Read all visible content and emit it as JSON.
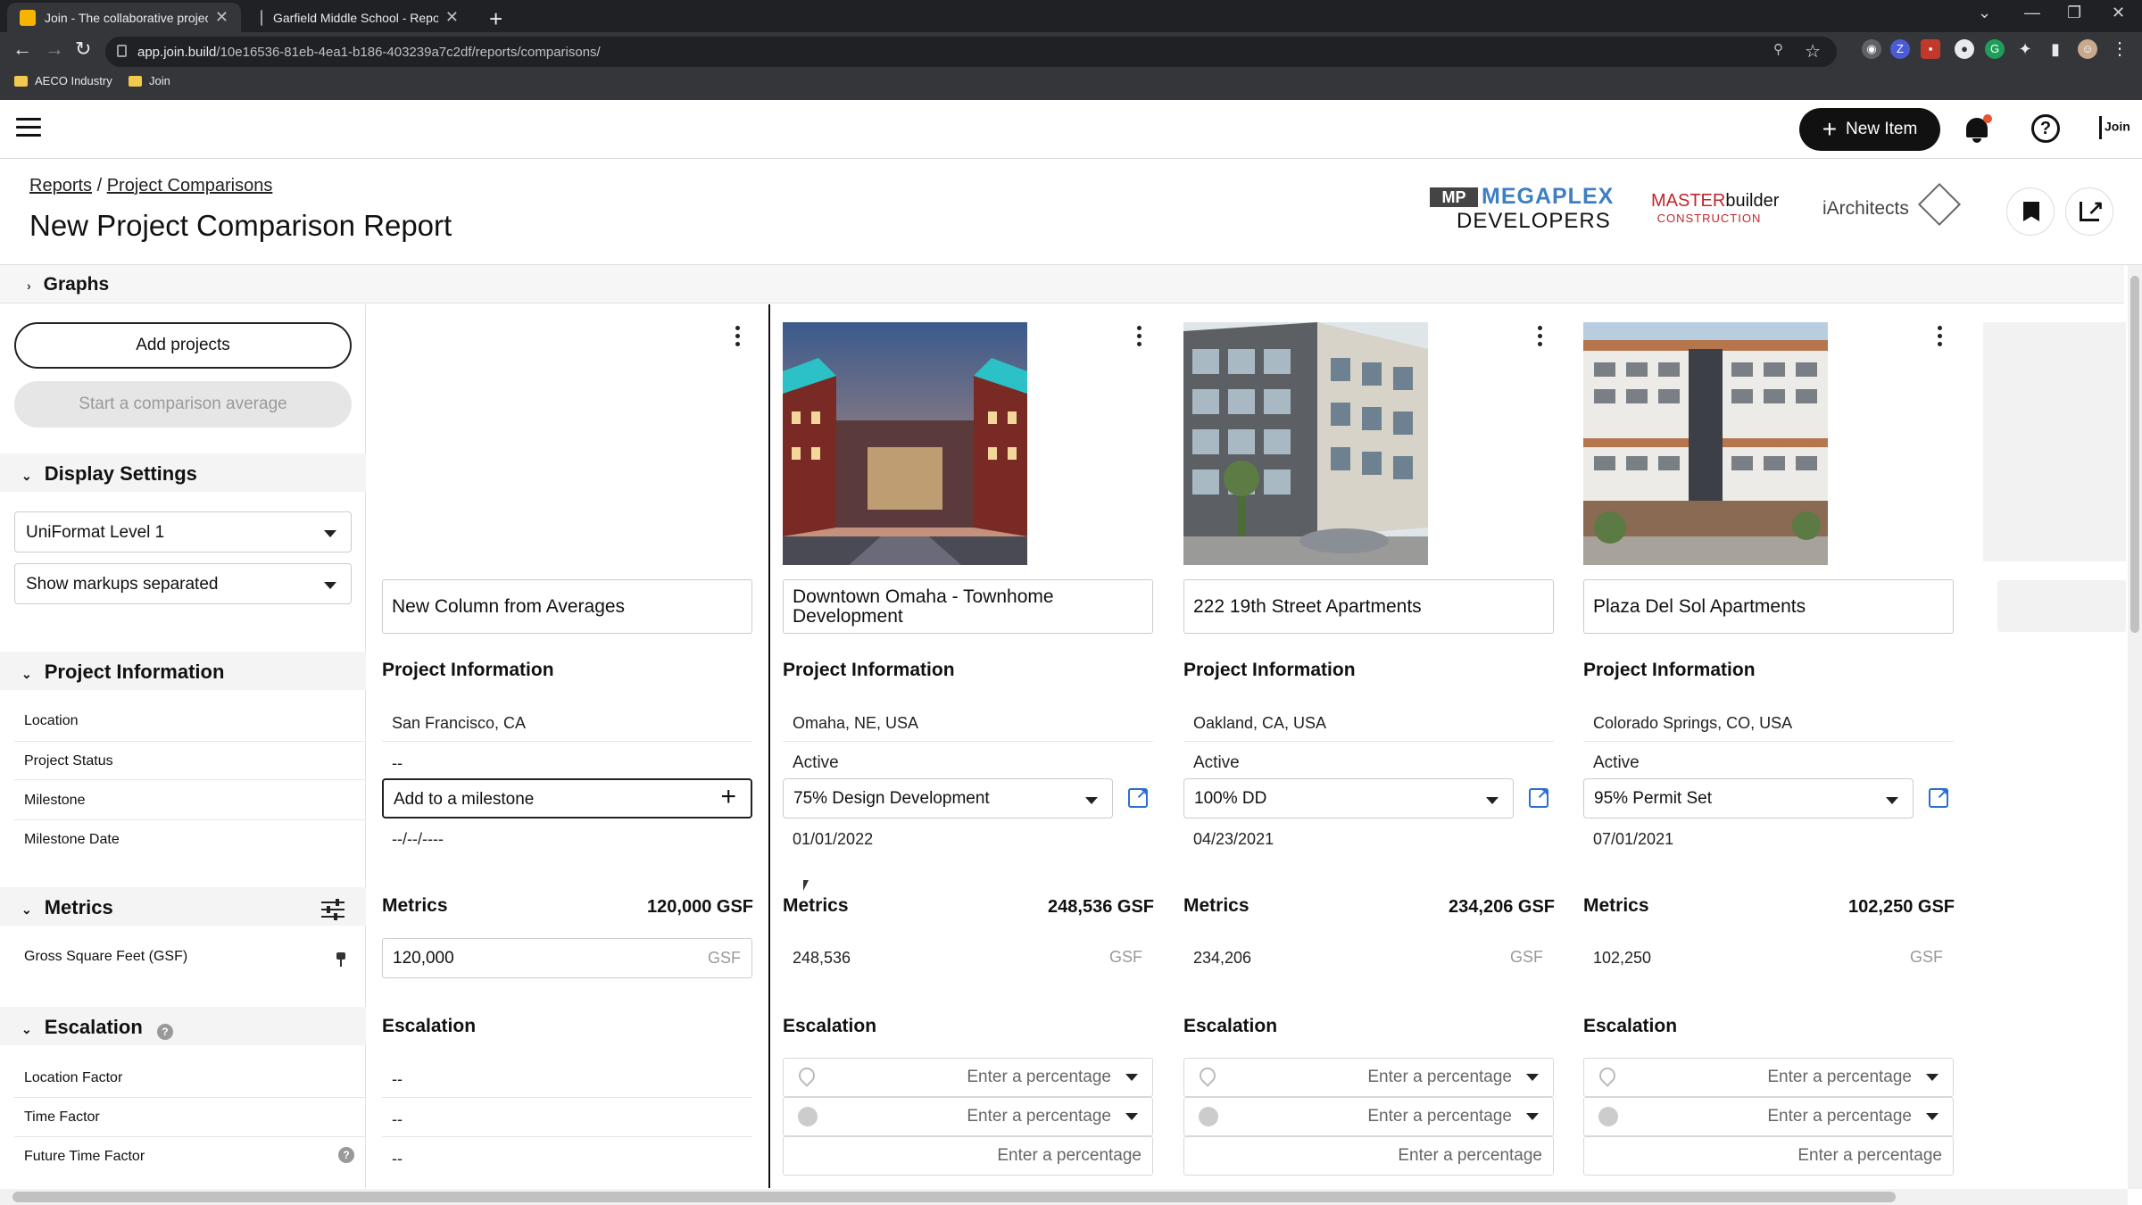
{
  "browser": {
    "tabs": [
      {
        "title": "Join - The collaborative project d",
        "active": true
      },
      {
        "title": "Garfield Middle School - Reports",
        "active": false
      }
    ],
    "url_domain": "app.join.build",
    "url_path": "/10e16536-81eb-4ea1-b186-403239a7c2df/reports/comparisons/",
    "bookmarks": [
      "AECO Industry",
      "Join"
    ]
  },
  "appbar": {
    "new_item_label": "New Item"
  },
  "header": {
    "breadcrumb_reports": "Reports",
    "breadcrumb_sep": "/",
    "breadcrumb_comparisons": "Project Comparisons",
    "title": "New Project Comparison Report",
    "logos": {
      "megaplex_mark": "MP",
      "megaplex_line1": "MEGAPLEX",
      "megaplex_line2": "DEVELOPERS",
      "master_a": "MASTER",
      "master_b": "builder",
      "master_c": "CONSTRUCTION",
      "iarchitects": "iArchitects"
    }
  },
  "graphs_label": "Graphs",
  "sidebar": {
    "add_projects": "Add projects",
    "start_average": "Start a comparison average",
    "display_settings": "Display Settings",
    "uniformat": "UniFormat Level 1",
    "markups": "Show markups separated",
    "project_information": "Project Information",
    "rows": {
      "location": "Location",
      "status": "Project Status",
      "milestone": "Milestone",
      "milestone_date": "Milestone Date"
    },
    "metrics": "Metrics",
    "gsf_label": "Gross Square Feet (GSF)",
    "escalation": "Escalation",
    "location_factor": "Location Factor",
    "time_factor": "Time Factor",
    "future_time_factor": "Future Time Factor"
  },
  "labels": {
    "project_information": "Project Information",
    "metrics": "Metrics",
    "escalation": "Escalation",
    "gsf_unit": "GSF",
    "enter_percentage": "Enter a percentage",
    "add_milestone": "Add to a milestone",
    "dash": "--",
    "empty_date": "--/--/----"
  },
  "avg_column": {
    "name": "New Column from Averages",
    "location": "San Francisco, CA",
    "status": "--",
    "metrics_total": "120,000 GSF",
    "gsf_value": "120,000"
  },
  "projects": [
    {
      "name": "Downtown Omaha - Townhome Development",
      "location": "Omaha, NE, USA",
      "status": "Active",
      "milestone": "75% Design Development",
      "milestone_date": "01/01/2022",
      "metrics_total": "248,536 GSF",
      "gsf_value": "248,536"
    },
    {
      "name": "222 19th Street Apartments",
      "location": "Oakland, CA, USA",
      "status": "Active",
      "milestone": "100% DD",
      "milestone_date": "04/23/2021",
      "metrics_total": "234,206 GSF",
      "gsf_value": "234,206"
    },
    {
      "name": "Plaza Del Sol Apartments",
      "location": "Colorado Springs, CO, USA",
      "status": "Active",
      "milestone": "95% Permit Set",
      "milestone_date": "07/01/2021",
      "metrics_total": "102,250 GSF",
      "gsf_value": "102,250"
    }
  ],
  "colors": {
    "accent_blue": "#2d6fcf",
    "megaplex_blue": "#3d7fc4",
    "master_red": "#c0262d",
    "notification": "#e8542d"
  }
}
